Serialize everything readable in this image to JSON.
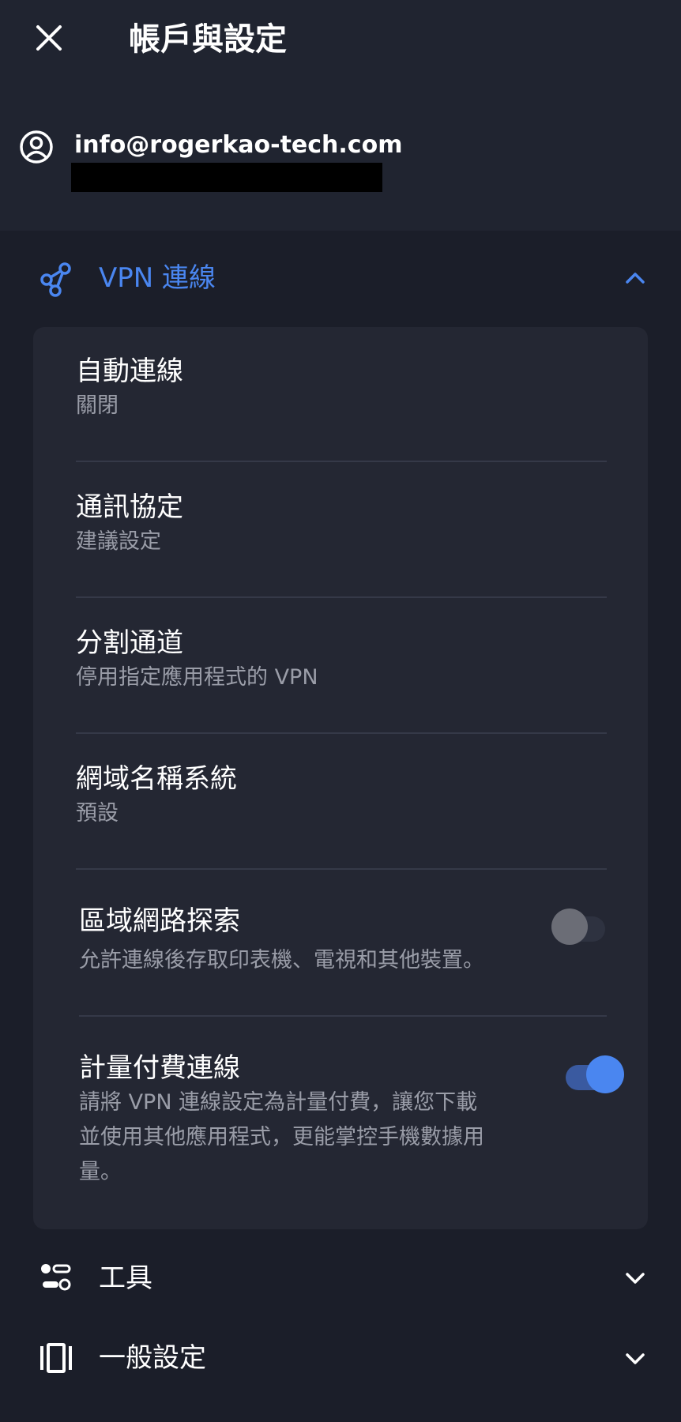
{
  "header": {
    "title": "帳戶與設定",
    "close_icon": "close-icon"
  },
  "account": {
    "email": "info@rogerkao-tech.com",
    "icon": "account-circle-icon"
  },
  "vpn_section": {
    "label": "VPN 連線",
    "icon": "share-nodes-icon",
    "expanded": true,
    "accent_color": "#4a86f0"
  },
  "settings": {
    "auto_connect": {
      "title": "自動連線",
      "value": "關閉"
    },
    "protocol": {
      "title": "通訊協定",
      "value": "建議設定"
    },
    "split_tunnel": {
      "title": "分割通道",
      "value": "停用指定應用程式的 VPN"
    },
    "dns": {
      "title": "網域名稱系統",
      "value": "預設"
    },
    "lan_discovery": {
      "title": "區域網路探索",
      "description": "允許連線後存取印表機、電視和其他裝置。",
      "enabled": false
    },
    "metered": {
      "title": "計量付費連線",
      "description_line1": "請將 VPN 連線設定為計量付費，讓您下載",
      "description_line2": "並使用其他應用程式，更能掌控手機數據用",
      "description_line3": "量。",
      "enabled": true
    }
  },
  "tools_section": {
    "label": "工具",
    "icon": "toggles-icon",
    "expanded": false
  },
  "general_section": {
    "label": "一般設定",
    "icon": "carousel-icon",
    "expanded": false
  }
}
